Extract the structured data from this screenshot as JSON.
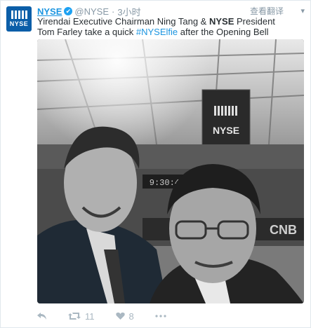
{
  "tweet": {
    "author_name": "NYSE",
    "verified_badge": "✔",
    "handle": "@NYSE",
    "separator": "·",
    "time": "3小时",
    "translate_label": "查看翻译",
    "more_icon": "chevron-down-icon",
    "text_part1": "Yirendai Executive Chairman Ning Tang & ",
    "text_bold": "NYSE",
    "text_part2": " President Tom Farley take a quick ",
    "hashtag": "#NYSElfie",
    "text_part3": " after the Opening Bell",
    "photo": {
      "sign_text": "NYSE",
      "ticker_text": "9:30:49",
      "banner_text": "CNB"
    },
    "actions": {
      "reply_icon": "reply-icon",
      "retweet_icon": "retweet-icon",
      "retweet_count": "11",
      "like_icon": "heart-icon",
      "like_count": "8",
      "more_icon": "more-dots-icon"
    }
  },
  "avatar": {
    "logo_text": "NYSE"
  },
  "colors": {
    "link": "#1b95e0",
    "muted": "#8899a6",
    "avatar_bg": "#0b5ea8"
  }
}
